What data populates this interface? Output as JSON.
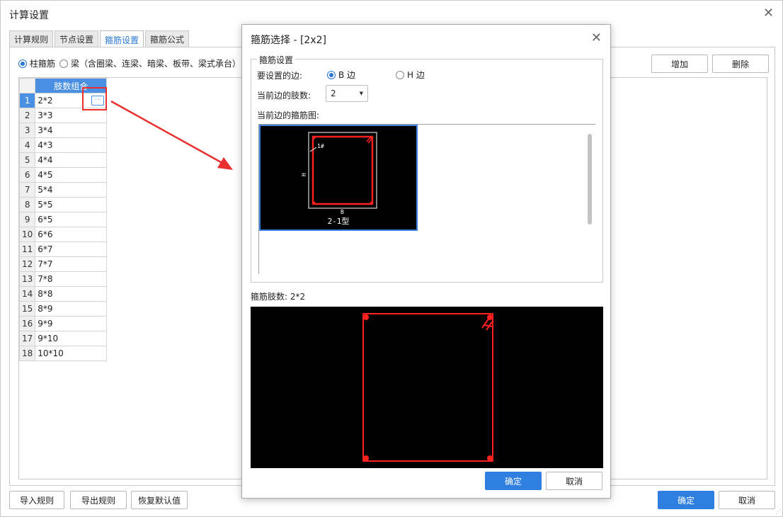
{
  "window": {
    "title": "计算设置"
  },
  "tabs": [
    {
      "label": "计算规则",
      "active": false
    },
    {
      "label": "节点设置",
      "active": false
    },
    {
      "label": "箍筋设置",
      "active": true
    },
    {
      "label": "箍筋公式",
      "active": false
    }
  ],
  "options": {
    "column_label": "柱箍筋",
    "beam_label": "梁（含圈梁、连梁、暗梁、板带、梁式承台）"
  },
  "actions": {
    "add_label": "增加",
    "delete_label": "删除"
  },
  "grid": {
    "header": "肢数组合",
    "rows": [
      {
        "num": "1",
        "value": "2*2"
      },
      {
        "num": "2",
        "value": "3*3"
      },
      {
        "num": "3",
        "value": "3*4"
      },
      {
        "num": "4",
        "value": "4*3"
      },
      {
        "num": "5",
        "value": "4*4"
      },
      {
        "num": "6",
        "value": "4*5"
      },
      {
        "num": "7",
        "value": "5*4"
      },
      {
        "num": "8",
        "value": "5*5"
      },
      {
        "num": "9",
        "value": "6*5"
      },
      {
        "num": "10",
        "value": "6*6"
      },
      {
        "num": "11",
        "value": "6*7"
      },
      {
        "num": "12",
        "value": "7*7"
      },
      {
        "num": "13",
        "value": "7*8"
      },
      {
        "num": "14",
        "value": "8*8"
      },
      {
        "num": "15",
        "value": "8*9"
      },
      {
        "num": "16",
        "value": "9*9"
      },
      {
        "num": "17",
        "value": "9*10"
      },
      {
        "num": "18",
        "value": "10*10"
      }
    ]
  },
  "footer": {
    "import_label": "导入规则",
    "export_label": "导出规则",
    "restore_label": "恢复默认值",
    "ok_label": "确定",
    "cancel_label": "取消"
  },
  "dialog": {
    "title": "箍筋选择 - [2x2]",
    "group_title": "箍筋设置",
    "side_label": "要设置的边:",
    "side_b": "B 边",
    "side_h": "H 边",
    "count_label": "当前边的肢数:",
    "count_value": "2",
    "diagram_label": "当前边的箍筋图:",
    "thumb": {
      "caption": "2-1型",
      "tag": "1#",
      "b_label": "B",
      "h_label": "H"
    },
    "legs_label": "箍筋肢数: 2*2",
    "ok_label": "确定",
    "cancel_label": "取消"
  },
  "colors": {
    "accent": "#2f7fe0",
    "highlight": "#ea2f2f",
    "stirrup": "#ff2020"
  }
}
